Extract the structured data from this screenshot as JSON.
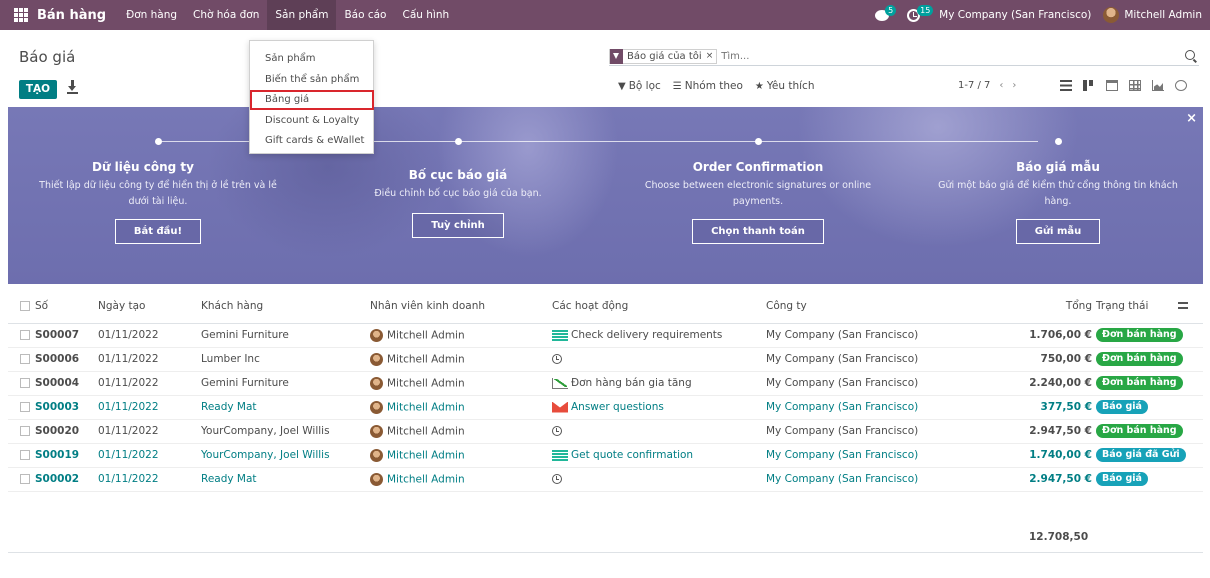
{
  "navbar": {
    "app_name": "Bán hàng",
    "menu": [
      "Đơn hàng",
      "Chờ hóa đơn",
      "Sản phẩm",
      "Báo cáo",
      "Cấu hình"
    ],
    "chat_count": "5",
    "activity_count": "15",
    "company": "My Company (San Francisco)",
    "user": "Mitchell Admin"
  },
  "page": {
    "title": "Báo giá",
    "create_label": "TẠO"
  },
  "search": {
    "facet_label": "Báo giá của tôi",
    "facet_remove": "×",
    "placeholder": "Tìm..."
  },
  "filters": {
    "filter_label": "Bộ lọc",
    "group_label": "Nhóm theo",
    "favorite_label": "Yêu thích"
  },
  "pager": {
    "value": "1-7 / 7",
    "prev": "‹",
    "next": "›"
  },
  "dropdown": {
    "items": [
      "Sản phẩm",
      "Biến thể sản phẩm",
      "Bảng giá",
      "Discount & Loyalty",
      "Gift cards & eWallet"
    ],
    "highlighted": "Bảng giá"
  },
  "banner": {
    "close": "×",
    "steps": [
      {
        "title": "Dữ liệu công ty",
        "desc": "Thiết lập dữ liệu công ty để hiển thị ở lề trên và lề dưới tài liệu.",
        "button": "Bắt đầu!"
      },
      {
        "title": "Bố cục báo giá",
        "desc": "Điều chỉnh bố cục báo giá của bạn.",
        "button": "Tuỳ chỉnh"
      },
      {
        "title": "Order Confirmation",
        "desc": "Choose between electronic signatures or online payments.",
        "button": "Chọn thanh toán"
      },
      {
        "title": "Báo giá mẫu",
        "desc": "Gửi một báo giá để kiểm thử cổng thông tin khách hàng.",
        "button": "Gửi mẫu"
      }
    ]
  },
  "table": {
    "headers": {
      "number": "Số",
      "date": "Ngày tạo",
      "customer": "Khách hàng",
      "salesperson": "Nhân viên kinh doanh",
      "activities": "Các hoạt động",
      "company": "Công ty",
      "total": "Tổng",
      "status": "Trạng thái"
    },
    "rows": [
      {
        "number": "S00007",
        "date": "01/11/2022",
        "customer": "Gemini Furniture",
        "salesperson": "Mitchell Admin",
        "activity_icon": "checklist-icon",
        "activity": "Check delivery requirements",
        "company": "My Company (San Francisco)",
        "total": "1.706,00 €",
        "status": "Đơn bán hàng",
        "status_color": "#28a745",
        "highlight": false
      },
      {
        "number": "S00006",
        "date": "01/11/2022",
        "customer": "Lumber Inc",
        "salesperson": "Mitchell Admin",
        "activity_icon": "clock-icon",
        "activity": "",
        "company": "My Company (San Francisco)",
        "total": "750,00 €",
        "status": "Đơn bán hàng",
        "status_color": "#28a745",
        "highlight": false
      },
      {
        "number": "S00004",
        "date": "01/11/2022",
        "customer": "Gemini Furniture",
        "salesperson": "Mitchell Admin",
        "activity_icon": "upsell-chart-icon",
        "activity": "Đơn hàng bán gia tăng",
        "company": "My Company (San Francisco)",
        "total": "2.240,00 €",
        "status": "Đơn bán hàng",
        "status_color": "#28a745",
        "highlight": false
      },
      {
        "number": "S00003",
        "date": "01/11/2022",
        "customer": "Ready Mat",
        "salesperson": "Mitchell Admin",
        "activity_icon": "email-icon",
        "activity": "Answer questions",
        "company": "My Company (San Francisco)",
        "total": "377,50 €",
        "status": "Báo giá",
        "status_color": "#17a2b8",
        "highlight": true
      },
      {
        "number": "S00020",
        "date": "01/11/2022",
        "customer": "YourCompany, Joel Willis",
        "salesperson": "Mitchell Admin",
        "activity_icon": "clock-icon",
        "activity": "",
        "company": "My Company (San Francisco)",
        "total": "2.947,50 €",
        "status": "Đơn bán hàng",
        "status_color": "#28a745",
        "highlight": false
      },
      {
        "number": "S00019",
        "date": "01/11/2022",
        "customer": "YourCompany, Joel Willis",
        "salesperson": "Mitchell Admin",
        "activity_icon": "checklist-icon",
        "activity": "Get quote confirmation",
        "company": "My Company (San Francisco)",
        "total": "1.740,00 €",
        "status": "Báo giá đã Gửi",
        "status_color": "#17a2b8",
        "highlight": true
      },
      {
        "number": "S00002",
        "date": "01/11/2022",
        "customer": "Ready Mat",
        "salesperson": "Mitchell Admin",
        "activity_icon": "clock-icon",
        "activity": "",
        "company": "My Company (San Francisco)",
        "total": "2.947,50 €",
        "status": "Báo giá",
        "status_color": "#17a2b8",
        "highlight": true
      }
    ],
    "grand_total": "12.708,50"
  }
}
